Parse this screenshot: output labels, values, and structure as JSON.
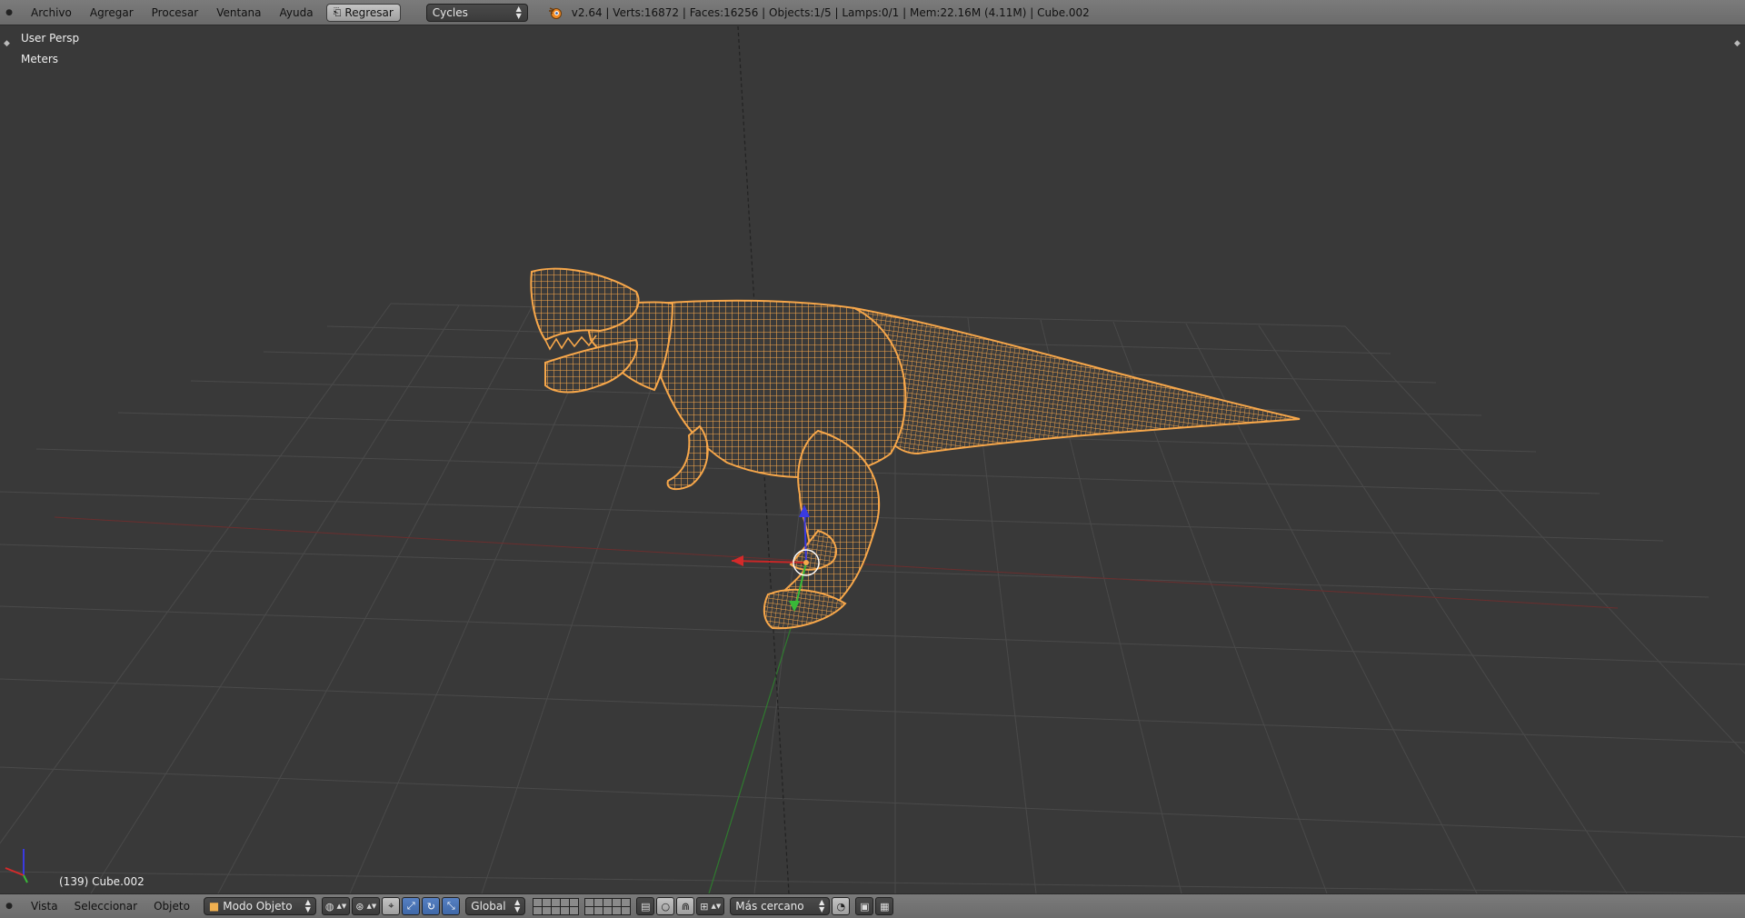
{
  "top_header": {
    "menus": [
      "Archivo",
      "Agregar",
      "Procesar",
      "Ventana",
      "Ayuda"
    ],
    "back_button": "Regresar",
    "render_engine": "Cycles",
    "stats": "v2.64 | Verts:16872 | Faces:16256 | Objects:1/5 | Lamps:0/1 | Mem:22.16M (4.11M) | Cube.002"
  },
  "viewport": {
    "view_name": "User Persp",
    "units": "Meters",
    "active_object": "(139) Cube.002",
    "wire_color": "#f7a74a",
    "axis_colors": {
      "x": "#d42a2a",
      "y": "#38b838",
      "z": "#3a3ae0"
    }
  },
  "bottom_header": {
    "menus": [
      "Vista",
      "Seleccionar",
      "Objeto"
    ],
    "mode": "Modo Objeto",
    "orientation": "Global",
    "snap_target": "Más cercano"
  }
}
